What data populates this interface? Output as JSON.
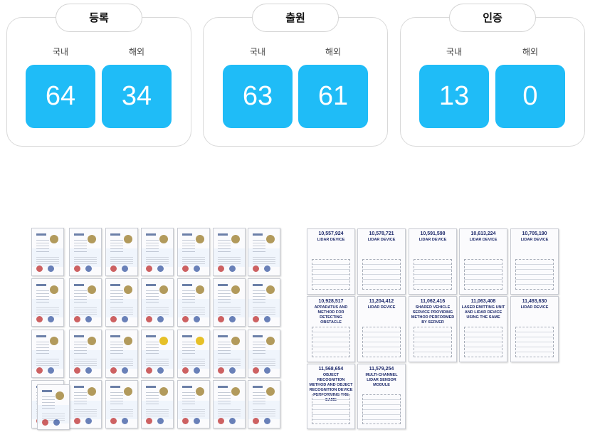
{
  "stats": [
    {
      "title": "등록",
      "domestic_label": "국내",
      "overseas_label": "해외",
      "domestic": "64",
      "overseas": "34"
    },
    {
      "title": "출원",
      "domestic_label": "국내",
      "overseas_label": "해외",
      "domestic": "63",
      "overseas": "61"
    },
    {
      "title": "인증",
      "domestic_label": "국내",
      "overseas_label": "해외",
      "domestic": "13",
      "overseas": "0"
    }
  ],
  "colors": {
    "accent": "#1fbcf7",
    "card_border": "#d9d9d9"
  },
  "patents": [
    {
      "number": "10,557,924",
      "title": "LIDAR DEVICE"
    },
    {
      "number": "10,578,721",
      "title": "LIDAR DEVICE"
    },
    {
      "number": "10,591,598",
      "title": "LIDAR DEVICE"
    },
    {
      "number": "10,613,224",
      "title": "LIDAR DEVICE"
    },
    {
      "number": "10,705,190",
      "title": "LIDAR DEVICE"
    },
    {
      "number": "10,928,517",
      "title": "APPARATUS AND METHOD FOR DETECTING OBSTACLE"
    },
    {
      "number": "11,204,412",
      "title": "LIDAR DEVICE"
    },
    {
      "number": "11,062,416",
      "title": "SHARED VEHICLE SERVICE PROVIDING METHOD PERFORMED BY SERVER"
    },
    {
      "number": "11,063,408",
      "title": "LASER EMITTING UNIT AND LIDAR DEVICE USING THE SAME"
    },
    {
      "number": "11,493,630",
      "title": "LIDAR DEVICE"
    },
    {
      "number": "11,568,654",
      "title": "OBJECT RECOGNITION METHOD AND OBJECT RECOGNITION DEVICE PERFORMING THE SAME"
    },
    {
      "number": "11,579,254",
      "title": "MULTI-CHANNEL LIDAR SENSOR MODULE"
    }
  ]
}
